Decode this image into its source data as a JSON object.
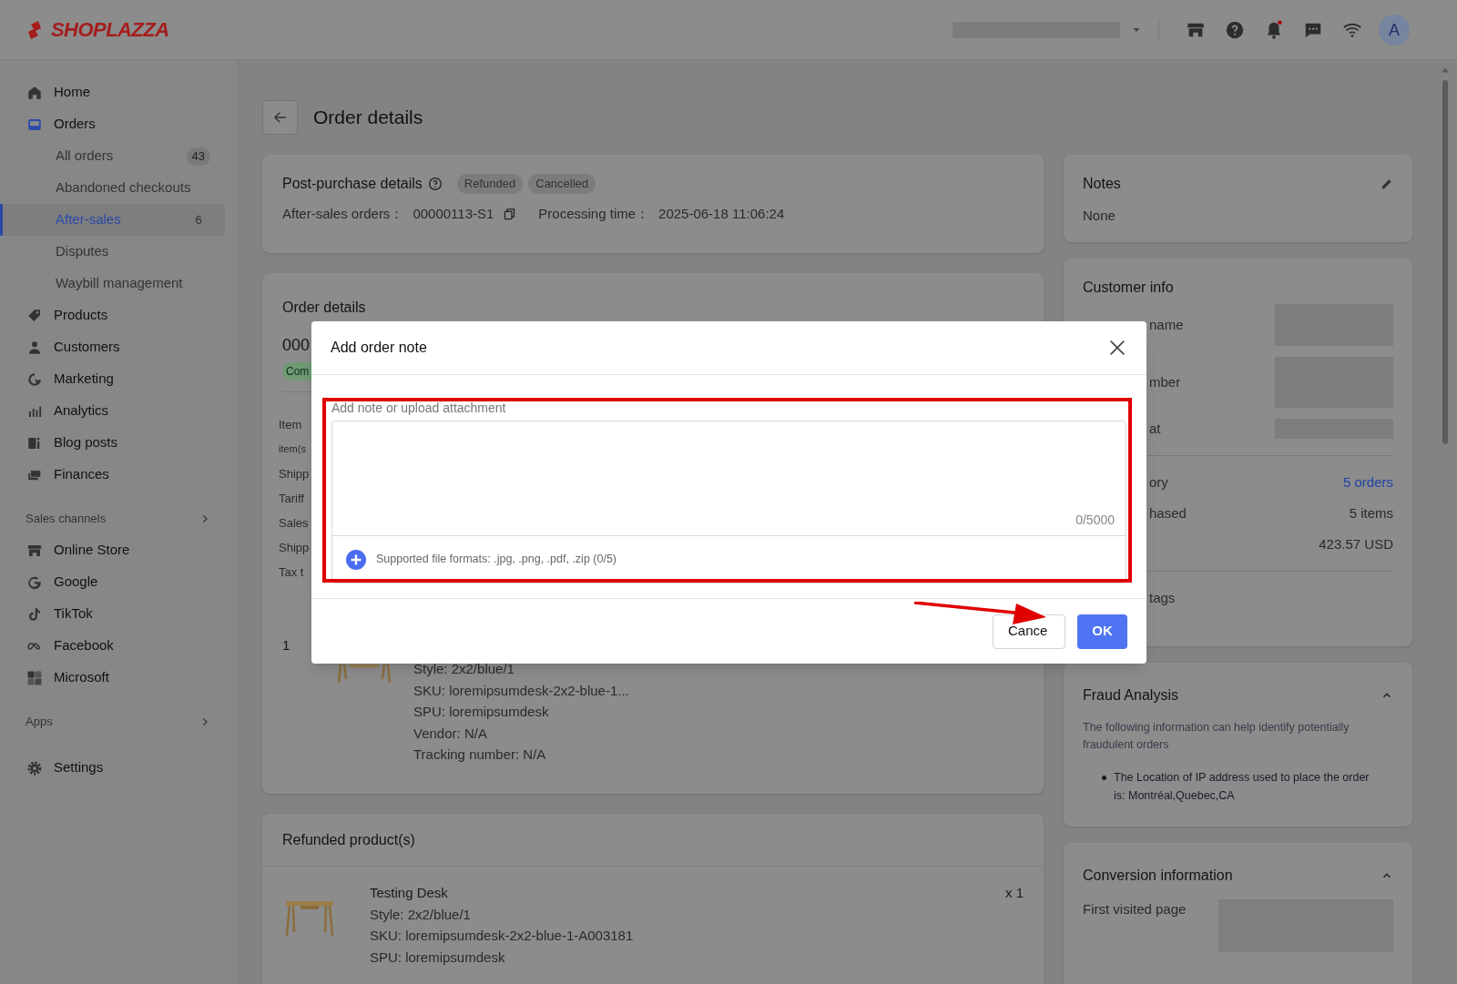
{
  "topbar": {
    "logo": "SHOPLAZZA",
    "avatar": "A"
  },
  "sidebar": {
    "items": [
      {
        "label": "Home",
        "selected": false
      },
      {
        "label": "Orders",
        "selected": false,
        "children": [
          {
            "label": "All orders",
            "badge": "43",
            "selected": false
          },
          {
            "label": "Abandoned checkouts",
            "selected": false
          },
          {
            "label": "After-sales",
            "badge": "6",
            "selected": true
          },
          {
            "label": "Disputes",
            "selected": false
          },
          {
            "label": "Waybill management",
            "selected": false
          }
        ]
      },
      {
        "label": "Products",
        "selected": false
      },
      {
        "label": "Customers",
        "selected": false
      },
      {
        "label": "Marketing",
        "selected": false
      },
      {
        "label": "Analytics",
        "selected": false
      },
      {
        "label": "Blog posts",
        "selected": false
      },
      {
        "label": "Finances",
        "selected": false
      }
    ],
    "sales_channels": {
      "title": "Sales channels",
      "items": [
        {
          "label": "Online Store",
          "selected": false
        },
        {
          "label": "Google",
          "selected": false
        },
        {
          "label": "TikTok",
          "selected": false
        },
        {
          "label": "Facebook",
          "selected": false
        },
        {
          "label": "Microsoft",
          "selected": false
        }
      ]
    },
    "apps": {
      "title": "Apps"
    },
    "footer_items": [
      {
        "label": "Settings",
        "selected": false
      }
    ]
  },
  "page": {
    "title": "Order details"
  },
  "post_purchase": {
    "title": "Post-purchase details",
    "badges": [
      "Refunded",
      "Cancelled"
    ],
    "fields": [
      {
        "label": "After-sales orders：",
        "value": "00000113-S1"
      },
      {
        "label": "Processing time：",
        "value": "2025-06-18 11:06:24"
      }
    ]
  },
  "order_details": {
    "title": "Order details",
    "order_number": "000",
    "status": "Com",
    "rows": [
      "Item",
      "item(s",
      "Shipp",
      "Tariff",
      "Sales",
      "Shipp",
      "Tax t"
    ],
    "line_item": {
      "index": "1",
      "lines": [
        "Style: 2x2/blue/1",
        "SKU: loremipsumdesk-2x2-blue-1...",
        "SPU: loremipsumdesk",
        "Vendor: N/A",
        "Tracking number: N/A"
      ]
    }
  },
  "refunded": {
    "title": "Refunded product(s)",
    "items": [
      {
        "name": "Testing Desk",
        "quantity": "x 1",
        "lines": [
          "Style: 2x2/blue/1",
          "SKU: loremipsumdesk-2x2-blue-1-A003181",
          "SPU: loremipsumdesk"
        ]
      }
    ]
  },
  "notes": {
    "title": "Notes",
    "value": "None"
  },
  "customer_info": {
    "title": "Customer info",
    "rows": [
      {
        "label": "name",
        "kind": "redacted"
      },
      {
        "label": "mber",
        "kind": "redacted"
      },
      {
        "label": "at",
        "kind": "redacted"
      },
      {
        "kind": "divider"
      },
      {
        "label": "ory",
        "value": "5 orders",
        "kind": "link"
      },
      {
        "label": "hased",
        "value": "5 items",
        "kind": "text"
      },
      {
        "value": "423.57 USD",
        "kind": "text"
      },
      {
        "kind": "divider"
      },
      {
        "label": "tags",
        "kind": "text"
      }
    ]
  },
  "fraud": {
    "title": "Fraud Analysis",
    "expanded": true,
    "description": "The following information can help identify potentially fraudulent orders",
    "bullets": [
      "The Location of IP address used to place the order is: Montréal,Quebec,CA"
    ]
  },
  "conversion": {
    "title": "Conversion information",
    "expanded": true,
    "rows": [
      {
        "label": "First visited page"
      }
    ]
  },
  "modal": {
    "title": "Add order note",
    "field_label": "Add note or upload attachment",
    "counter": "0/5000",
    "attachment_hint": "Supported file formats: .jpg, .png, .pdf, .zip (0/5)",
    "buttons": [
      {
        "label": "Cance",
        "kind": "secondary"
      },
      {
        "label": "OK",
        "kind": "primary"
      }
    ]
  }
}
